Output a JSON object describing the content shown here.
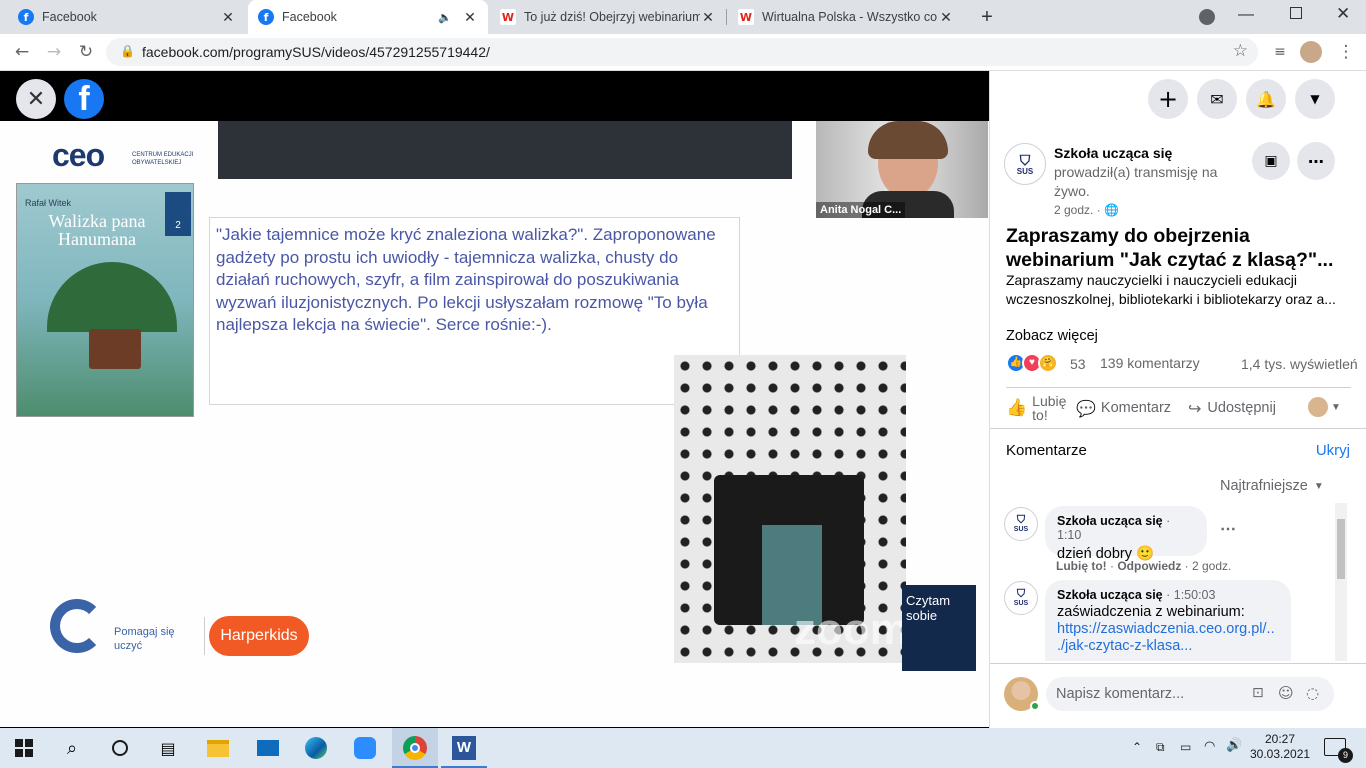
{
  "browser": {
    "tabs": [
      {
        "label": "Facebook",
        "icon": "facebook-favicon",
        "active": false
      },
      {
        "label": "Facebook",
        "icon": "facebook-favicon",
        "active": true
      },
      {
        "label": "To już dziś! Obejrzyj webinarium",
        "icon": "wp-favicon",
        "active": false
      },
      {
        "label": "Wirtualna Polska - Wszystko co w",
        "icon": "wp-favicon",
        "active": false
      }
    ],
    "url": "facebook.com/programySUS/videos/457291255719442/"
  },
  "video": {
    "speaker_name": "Anita Nogal C...",
    "slide_quote": "\"Jakie tajemnice może kryć znaleziona walizka?\". Zaproponowane gadżety po prostu ich uwiodły - tajemnicza walizka, chusty do działań ruchowych, szyfr, a film zainspirował do poszukiwania wyzwań iluzjonistycznych. Po lekcji usłyszałam rozmowę \"To była najlepsza lekcja na świecie\". Serce rośnie:-).",
    "ceo_logo": "ceo",
    "ceo_sub": "CENTRUM EDUKACJI OBYWATELSKIEJ",
    "book_author": "Rafał Witek",
    "book_title": "Walizka pana Hanumana",
    "book_badge": "2",
    "pomagaj": "Pomagaj się uczyć",
    "harperkids": "Harperkids",
    "zoom": "zoom",
    "czytam": "Czytam sobie"
  },
  "post": {
    "page_name": "Szkoła ucząca się",
    "action": "prowadził(a) transmisję na żywo.",
    "time": "2 godz. ·",
    "title": "Zapraszamy do obejrzenia webinarium \"Jak czytać z klasą?\"...",
    "body": "Zapraszamy nauczycielki i nauczycieli edukacji wczesnoszkolnej, bibliotekarki i bibliotekarzy oraz a...",
    "see_more": "Zobacz więcej",
    "reactions_count": "53",
    "comments_count": "139 komentarzy",
    "views": "1,4 tys. wyświetleń",
    "like": "Lubię to!",
    "comment": "Komentarz",
    "share": "Udostępnij"
  },
  "comments_section": {
    "heading": "Komentarze",
    "hide": "Ukryj",
    "sort": "Najtrafniejsze",
    "avatar_label": "SUS",
    "comments": [
      {
        "author": "Szkoła ucząca się",
        "time": "1:10",
        "text": "dzień dobry 🙂",
        "like": "Lubię to!",
        "reply": "Odpowiedz",
        "ago": "2 godz."
      },
      {
        "author": "Szkoła ucząca się",
        "time": "1:50:03",
        "text": "zaświadczenia z webinarium:",
        "link1": "https://zaswiadczenia.ceo.org.pl/..",
        "link2": "./jak-czytac-z-klasa..."
      }
    ],
    "input_placeholder": "Napisz komentarz..."
  },
  "taskbar": {
    "time": "20:27",
    "date": "30.03.2021",
    "notifications": "9"
  }
}
